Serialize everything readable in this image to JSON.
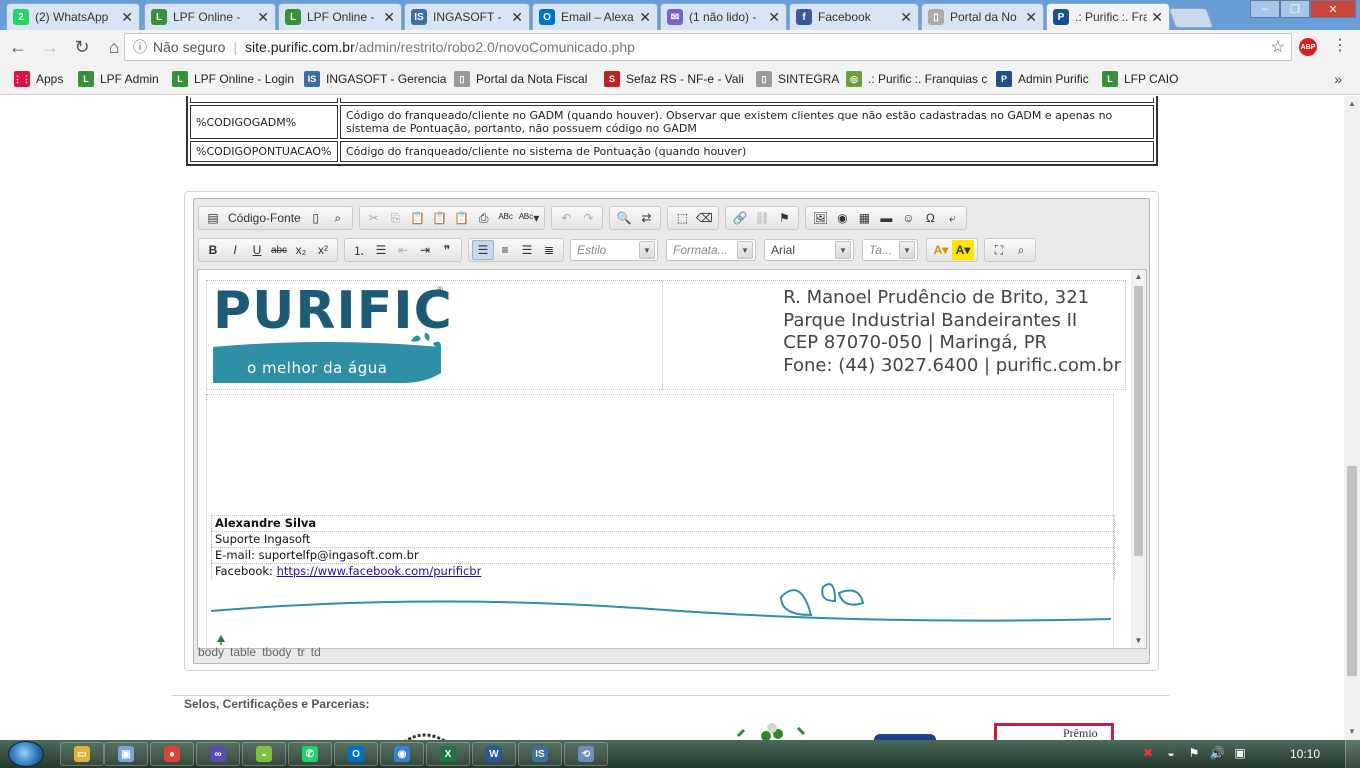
{
  "browser": {
    "tabs": [
      {
        "title": "(2) WhatsApp",
        "icon": "whatsapp-icon",
        "color": "#25d366",
        "glyph": "2"
      },
      {
        "title": "LPF Online -",
        "icon": "leaf-icon",
        "color": "#3a8f3a",
        "glyph": "L"
      },
      {
        "title": "LPF Online -",
        "icon": "leaf-icon",
        "color": "#3a8f3a",
        "glyph": "L"
      },
      {
        "title": "INGASOFT -",
        "icon": "ingasoft-icon",
        "color": "#3f6f9f",
        "glyph": "IS"
      },
      {
        "title": "Email – Alexa",
        "icon": "outlook-icon",
        "color": "#0072c6",
        "glyph": "O"
      },
      {
        "title": "(1 não lido) -",
        "icon": "mail-icon",
        "color": "#7b61c9",
        "glyph": "✉"
      },
      {
        "title": "Facebook",
        "icon": "facebook-icon",
        "color": "#3b5998",
        "glyph": "f"
      },
      {
        "title": "Portal da No",
        "icon": "page-icon",
        "color": "#aaaaaa",
        "glyph": "▯"
      },
      {
        "title": ".: Purific :. Fra",
        "icon": "purific-icon",
        "color": "#1d4f8a",
        "glyph": "P"
      }
    ],
    "url": {
      "security": "Não seguro",
      "host": "site.purific.com.br",
      "path": "/admin/restrito/robo2.0/novoComunicado.php"
    },
    "bookmarks": [
      {
        "label": "Apps",
        "icon": "apps-grid-icon",
        "color": "#d14",
        "glyph": "⋮⋮"
      },
      {
        "label": "LPF Admin",
        "icon": "leaf-icon",
        "color": "#3a8f3a",
        "glyph": "L"
      },
      {
        "label": "LPF Online - Login",
        "icon": "leaf-icon",
        "color": "#3a8f3a",
        "glyph": "L"
      },
      {
        "label": "INGASOFT - Gerencia",
        "icon": "ingasoft-icon",
        "color": "#3f6f9f",
        "glyph": "IS"
      },
      {
        "label": "Portal da Nota Fiscal",
        "icon": "page-icon",
        "color": "#999999",
        "glyph": "▯"
      },
      {
        "label": "Sefaz RS - NF-e - Vali",
        "icon": "sefaz-icon",
        "color": "#b22",
        "glyph": "S"
      },
      {
        "label": "SINTEGRA",
        "icon": "page-icon",
        "color": "#999999",
        "glyph": "▯"
      },
      {
        "label": ".: Purific :. Franquias c",
        "icon": "globe-icon",
        "color": "#6b9f3b",
        "glyph": "◎"
      },
      {
        "label": "Admin Purific",
        "icon": "purific-icon",
        "color": "#1d4f8a",
        "glyph": "P"
      },
      {
        "label": "LFP CAIO",
        "icon": "leaf-icon",
        "color": "#3a8f3a",
        "glyph": "L"
      }
    ]
  },
  "variables_table": [
    {
      "key": "%CODIGOGADM%",
      "desc": "Código do franqueado/cliente no GADM (quando houver). Observar que existem clientes que não estão cadastradas no GADM e apenas no sistema de Pontuação, portanto, não possuem código no GADM"
    },
    {
      "key": "%CODIGOPONTUACAO%",
      "desc": "Código do franqueado/cliente no sistema de Pontuação (quando houver)"
    }
  ],
  "editor": {
    "toolbar_source_label": "Código-Fonte",
    "combos": {
      "style": "Estilo",
      "format": "Formata...",
      "font": "Arial",
      "size": "Ta..."
    },
    "header": {
      "logo_word": "PURIFIC",
      "logo_reg": "®",
      "logo_tagline": "o melhor da água",
      "address_lines": [
        "R. Manoel Prudêncio de Brito, 321",
        "Parque Industrial Bandeirantes II",
        "CEP 87070-050 | Maringá, PR",
        "Fone: (44) 3027.6400 | purific.com.br"
      ]
    },
    "signature": {
      "name": "Alexandre Silva",
      "role": "Suporte Ingasoft",
      "email_line": "E-mail: suportelfp@ingasoft.com.br",
      "facebook_prefix": "Facebook: ",
      "facebook_link": "https://www.facebook.com/purificbr"
    },
    "path": [
      "body",
      "table",
      "tbody",
      "tr",
      "td"
    ]
  },
  "page": {
    "selos_label": "Selos, Certificações e Parcerias:",
    "seal_text": "Prêmio"
  },
  "taskbar": {
    "clock": "10:10",
    "apps": [
      {
        "icon": "explorer-icon",
        "color": "#e0b23c",
        "glyph": "▭"
      },
      {
        "icon": "photos-icon",
        "color": "#7aa7d8",
        "glyph": "▣"
      },
      {
        "icon": "chrome-icon",
        "color": "#db4437",
        "glyph": "●"
      },
      {
        "icon": "messenger-icon",
        "color": "#5d4bb0",
        "glyph": "∞"
      },
      {
        "icon": "android-icon",
        "color": "#7fbf3f",
        "glyph": "◒"
      },
      {
        "icon": "whatsapp-icon",
        "color": "#25d366",
        "glyph": "✆"
      },
      {
        "icon": "outlook-icon",
        "color": "#0072c6",
        "glyph": "O"
      },
      {
        "icon": "device-icon",
        "color": "#3a7ed6",
        "glyph": "◉"
      },
      {
        "icon": "excel-icon",
        "color": "#1f7244",
        "glyph": "X"
      },
      {
        "icon": "word-icon",
        "color": "#2b579a",
        "glyph": "W"
      },
      {
        "icon": "ingasoft-icon",
        "color": "#3f6f9f",
        "glyph": "IS"
      },
      {
        "icon": "remote-icon",
        "color": "#6b8fb8",
        "glyph": "⟲"
      }
    ]
  }
}
